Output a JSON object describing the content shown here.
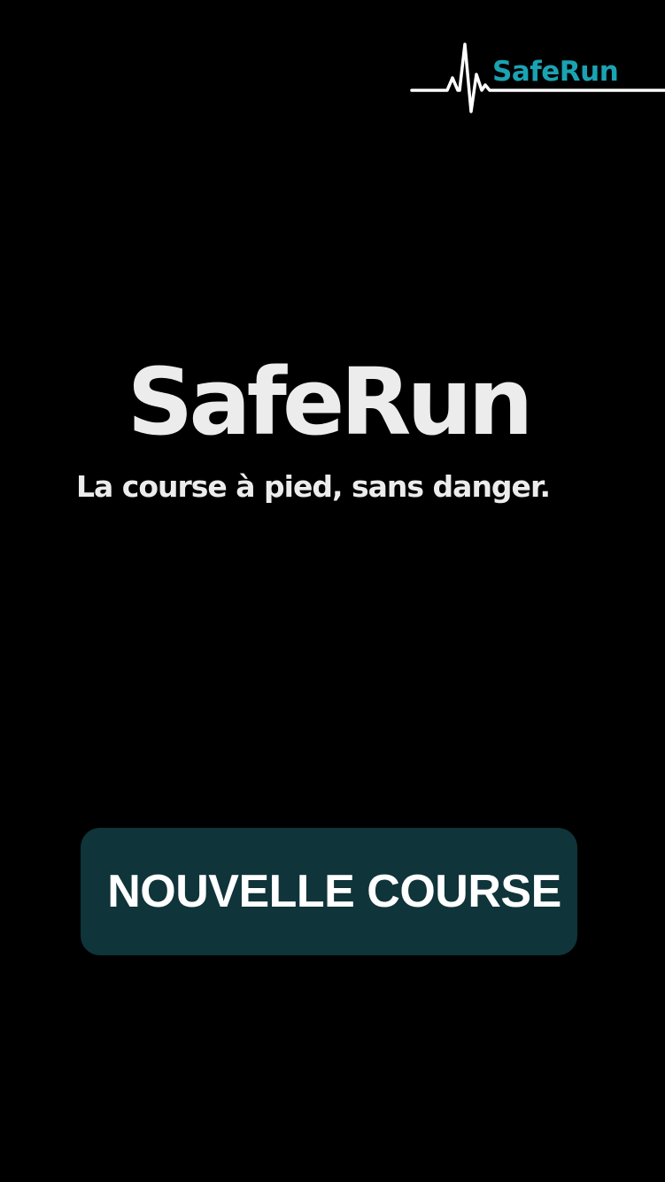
{
  "header": {
    "logo_text": "SafeRun",
    "logo_icon": "heartbeat-line-icon"
  },
  "hero": {
    "title": "SafeRun",
    "tagline": "La course à pied, sans danger."
  },
  "actions": {
    "new_run_label": "NOUVELLE COURSE"
  },
  "colors": {
    "background": "#000000",
    "brand_accent": "#1aa3b3",
    "text_light": "#ececec",
    "button_bg": "#0f343a",
    "button_text": "#ffffff",
    "logo_line": "#ffffff"
  }
}
